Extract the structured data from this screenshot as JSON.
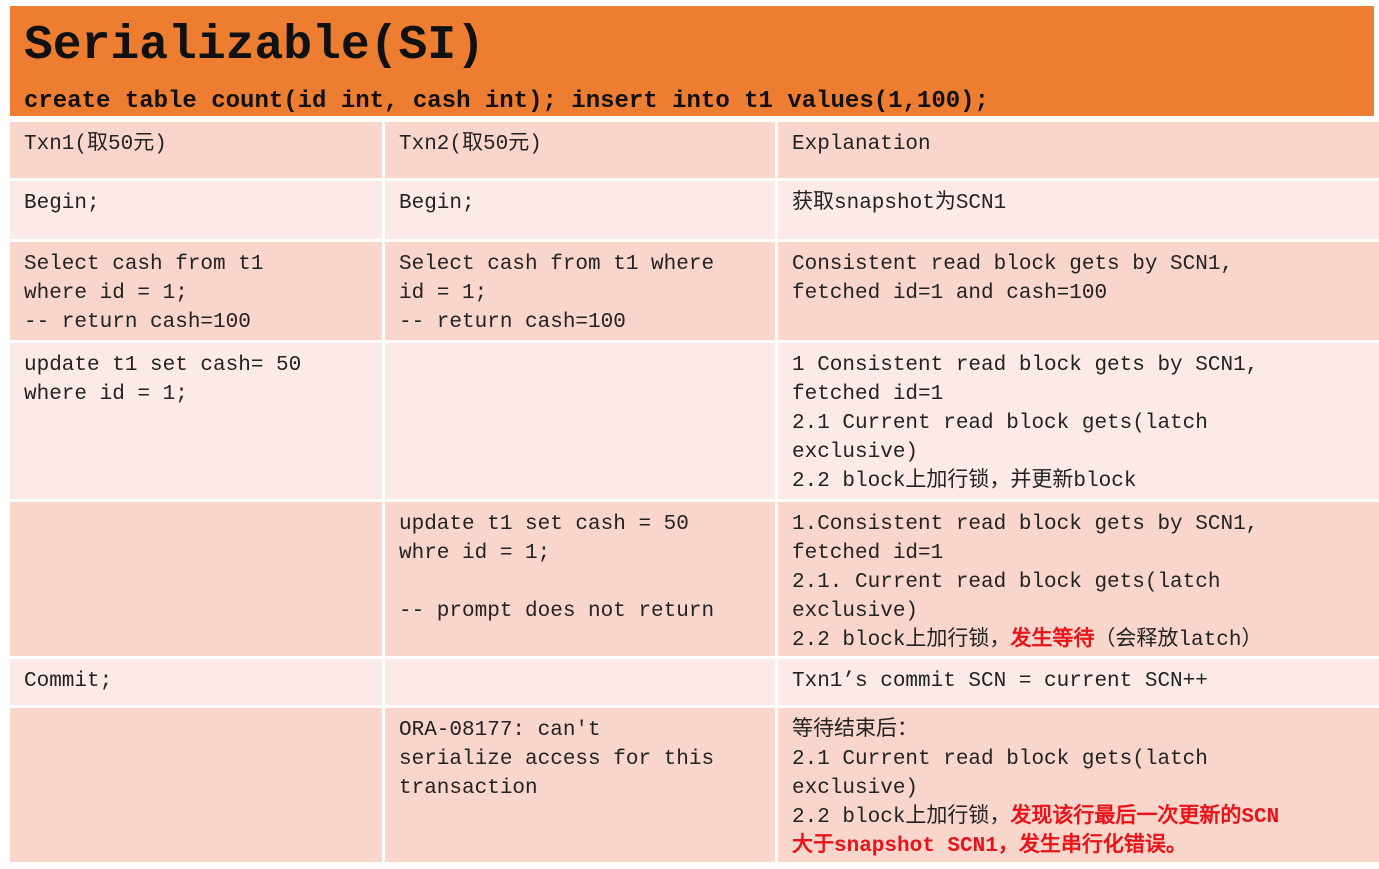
{
  "header": {
    "title": "Serializable(SI)",
    "subtitle": "create table count(id int, cash int); insert into t1 values(1,100);"
  },
  "colors": {
    "header_bg": "#ED7D31",
    "row_dark": "#F8D6CB",
    "row_light": "#FBEAE7",
    "highlight_red": "#E8141A"
  },
  "table": {
    "columns": [
      "Txn1(取50元)",
      "Txn2(取50元)",
      "Explanation"
    ],
    "rows": [
      {
        "txn1": "Begin;",
        "txn2": "Begin;",
        "explanation": "获取snapshot为SCN1"
      },
      {
        "txn1": "Select cash from t1\nwhere id = 1;\n-- return cash=100",
        "txn2": "Select cash from t1 where\nid = 1;\n-- return cash=100",
        "explanation": "Consistent read block gets by SCN1,\nfetched id=1 and cash=100"
      },
      {
        "txn1": "update t1 set cash= 50\nwhere id = 1;",
        "txn2": "",
        "explanation": "1 Consistent read block gets by SCN1,\nfetched id=1\n2.1 Current read block gets(latch\nexclusive)\n2.2 block上加行锁，并更新block"
      },
      {
        "txn1": "",
        "txn2": "update t1 set cash = 50\nwhre id = 1;\n\n-- prompt does not return",
        "explanation_plain": "1.Consistent read block gets by SCN1,\nfetched id=1\n2.1. Current read block gets(latch\nexclusive)\n2.2 block上加行锁，",
        "explanation_red": "发生等待",
        "explanation_tail": "（会释放latch）"
      },
      {
        "txn1": "Commit;",
        "txn2": "",
        "explanation": "Txn1’s commit SCN = current SCN++"
      },
      {
        "txn1": "",
        "txn2": "ORA-08177: can't\nserialize access for this\ntransaction",
        "explanation_plain": "等待结束后：\n2.1 Current read block gets(latch\nexclusive)\n2.2 block上加行锁，",
        "explanation_red": "发现该行最后一次更新的SCN\n大于snapshot SCN1，发生串行化错误。"
      }
    ]
  }
}
